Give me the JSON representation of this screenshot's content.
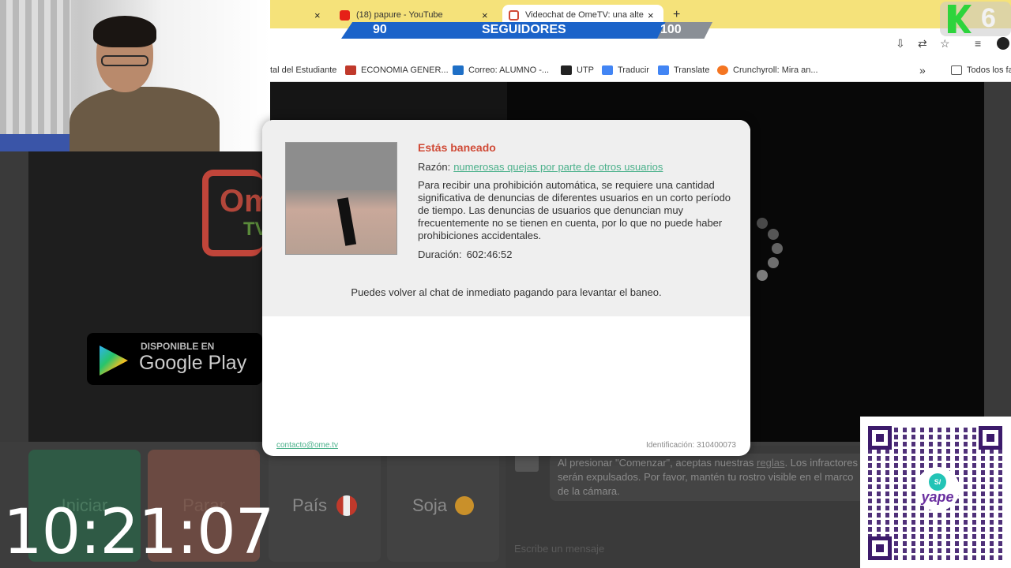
{
  "browser": {
    "tabs": [
      {
        "label": "(18) papure - YouTube",
        "icon": "youtube-icon"
      },
      {
        "label": "Videochat de OmeTV: una alter",
        "icon": "ometv-icon"
      }
    ],
    "new_tab": "+",
    "close_glyph": "×",
    "bookmarks": [
      {
        "label": "tal del Estudiante"
      },
      {
        "label": "ECONOMIA GENER..."
      },
      {
        "label": "Correo: ALUMNO -..."
      },
      {
        "label": "UTP"
      },
      {
        "label": "Traducir"
      },
      {
        "label": "Translate"
      },
      {
        "label": "Crunchyroll: Mira an..."
      }
    ],
    "more_bookmarks": "»",
    "all_bookmarks": "Todos los fa"
  },
  "followers": {
    "current": "90",
    "label": "SEGUIDORES",
    "goal": "100",
    "progress": 0.9
  },
  "brand_logo": {
    "number": "6"
  },
  "left_panel": {
    "logo_top": "Om",
    "logo_bottom": "TV",
    "store_small": "DISPONIBLE EN",
    "store_big": "Google Play"
  },
  "modal": {
    "title": "Estás baneado",
    "reason_label": "Razón:",
    "reason_value": "numerosas quejas por parte de otros usuarios",
    "description": "Para recibir una prohibición automática, se requiere una cantidad significativa de denuncias de diferentes usuarios en un corto período de tiempo. Las denuncias de usuarios que denuncian muy frecuentemente no se tienen en cuenta, por lo que no puede haber prohibiciones accidentales.",
    "duration_label": "Duración:",
    "duration_value": "602:46:52",
    "pay_text": "Puedes volver al chat de inmediato pagando para levantar el baneo.",
    "contact": "contacto@ome.tv",
    "ident": "Identificación: 310400073"
  },
  "controls": {
    "start": "Iniciar",
    "stop": "Parar",
    "country": "País",
    "gender": "Soja"
  },
  "chat": {
    "message_part1": "Al presionar \"Comenzar\", aceptas nuestras",
    "rules_link": "reglas",
    "message_part2": ". Los infractores serán expulsados. Por favor, mantén tu rostro visible en el marco de la cámara.",
    "input_placeholder": "Escribe un mensaje"
  },
  "clock": "10:21:07",
  "qr": {
    "brand": "yape",
    "coin": "S/"
  },
  "colors": {
    "ban_title": "#d04a36",
    "link": "#4ab08a",
    "followers_bar": "#1b63c9",
    "tab_bar": "#f5e27a"
  }
}
